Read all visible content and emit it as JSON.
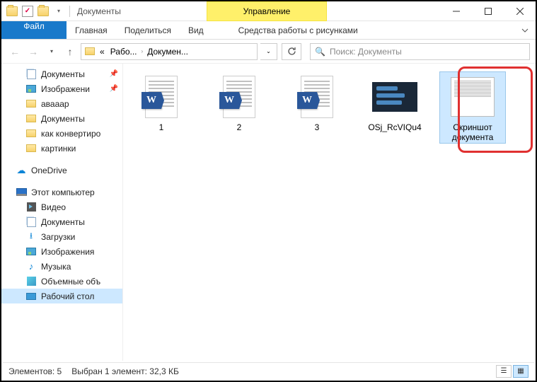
{
  "title": "Документы",
  "context_tab": "Управление",
  "ribbon": {
    "file": "Файл",
    "tabs": [
      "Главная",
      "Поделиться",
      "Вид"
    ],
    "context": "Средства работы с рисунками"
  },
  "breadcrumb": {
    "prefix": "«",
    "p1": "Рабо...",
    "p2": "Докумен..."
  },
  "search_placeholder": "Поиск: Документы",
  "sidebar": {
    "quick": [
      {
        "label": "Документы",
        "icon": "docs",
        "pinned": true
      },
      {
        "label": "Изображени",
        "icon": "pics",
        "pinned": true
      },
      {
        "label": "авааар",
        "icon": "folder"
      },
      {
        "label": "Документы",
        "icon": "folder"
      },
      {
        "label": "как конвертиро",
        "icon": "folder"
      },
      {
        "label": "картинки",
        "icon": "folder"
      }
    ],
    "onedrive": "OneDrive",
    "thispc": "Этот компьютер",
    "pc": [
      {
        "label": "Видео",
        "icon": "video"
      },
      {
        "label": "Документы",
        "icon": "docs"
      },
      {
        "label": "Загрузки",
        "icon": "dl"
      },
      {
        "label": "Изображения",
        "icon": "pics"
      },
      {
        "label": "Музыка",
        "icon": "music"
      },
      {
        "label": "Объемные объ",
        "icon": "3d"
      },
      {
        "label": "Рабочий стол",
        "icon": "desk",
        "selected": true
      }
    ]
  },
  "files": [
    {
      "name": "1",
      "type": "word"
    },
    {
      "name": "2",
      "type": "word"
    },
    {
      "name": "3",
      "type": "word"
    },
    {
      "name": "OSj_RcVIQu4",
      "type": "image"
    },
    {
      "name": "Скриншот документа",
      "type": "docimg",
      "selected": true
    }
  ],
  "status": {
    "count": "Элементов: 5",
    "selection": "Выбран 1 элемент: 32,3 КБ"
  }
}
